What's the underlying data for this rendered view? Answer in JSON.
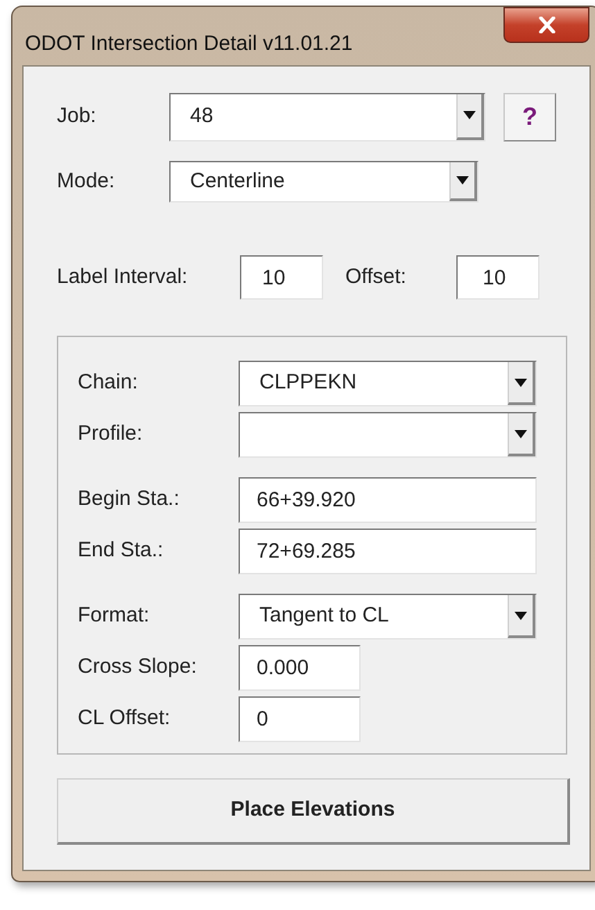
{
  "window": {
    "title": "ODOT Intersection Detail v11.01.21"
  },
  "job": {
    "label": "Job:",
    "value": "48",
    "help": "?"
  },
  "mode": {
    "label": "Mode:",
    "value": "Centerline"
  },
  "label_interval": {
    "label": "Label Interval:",
    "value": "10"
  },
  "offset": {
    "label": "Offset:",
    "value": "10"
  },
  "fields": [
    {
      "kind": "dropdown",
      "label": "Chain:",
      "value": "CLPPEKN"
    },
    {
      "kind": "dropdown",
      "label": "Profile:"
    },
    {
      "kind": "text",
      "label": "Begin Sta.:",
      "value": "66+39.920"
    },
    {
      "kind": "text",
      "label": "End Sta.:",
      "value": "72+69.285"
    },
    {
      "kind": "dropdown",
      "label": "Format:",
      "value": "Tangent to CL"
    },
    {
      "kind": "text",
      "label": "Cross Slope:",
      "value": "0.000"
    },
    {
      "kind": "text",
      "label": "CL Offset:",
      "value": "0"
    }
  ],
  "button": "Place Elevations"
}
